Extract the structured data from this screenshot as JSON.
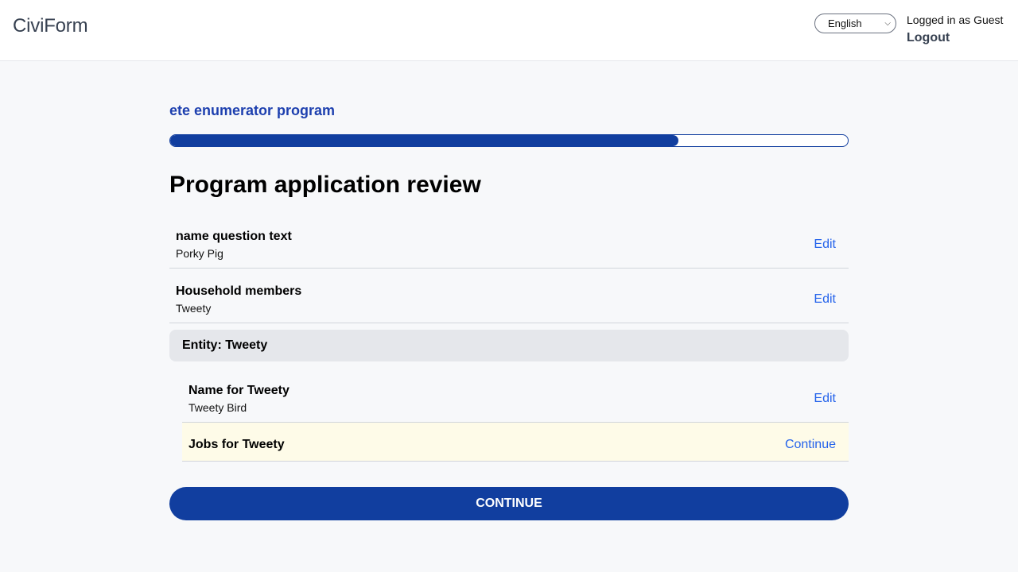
{
  "header": {
    "brand": "CiviForm",
    "language_select": {
      "selected": "English"
    },
    "login_status": "Logged in as Guest",
    "logout_label": "Logout"
  },
  "program": {
    "title": "ete enumerator program",
    "progress_fraction": 0.75
  },
  "page": {
    "title": "Program application review"
  },
  "questions": [
    {
      "question": "name question text",
      "answer": "Porky Pig",
      "action": "Edit"
    },
    {
      "question": "Household members",
      "answer": "Tweety",
      "action": "Edit"
    }
  ],
  "entity": {
    "header": "Entity: Tweety",
    "questions": [
      {
        "question": "Name for Tweety",
        "answer": "Tweety Bird",
        "action": "Edit"
      },
      {
        "question": "Jobs for Tweety",
        "answer": "",
        "action": "Continue"
      }
    ]
  },
  "continue_button_label": "CONTINUE",
  "colors": {
    "primary": "#113e9f",
    "link": "#2563eb",
    "pending_row_bg": "#fefbe8",
    "entity_header_bg": "#e5e7eb",
    "page_bg": "#f7f8fa"
  }
}
